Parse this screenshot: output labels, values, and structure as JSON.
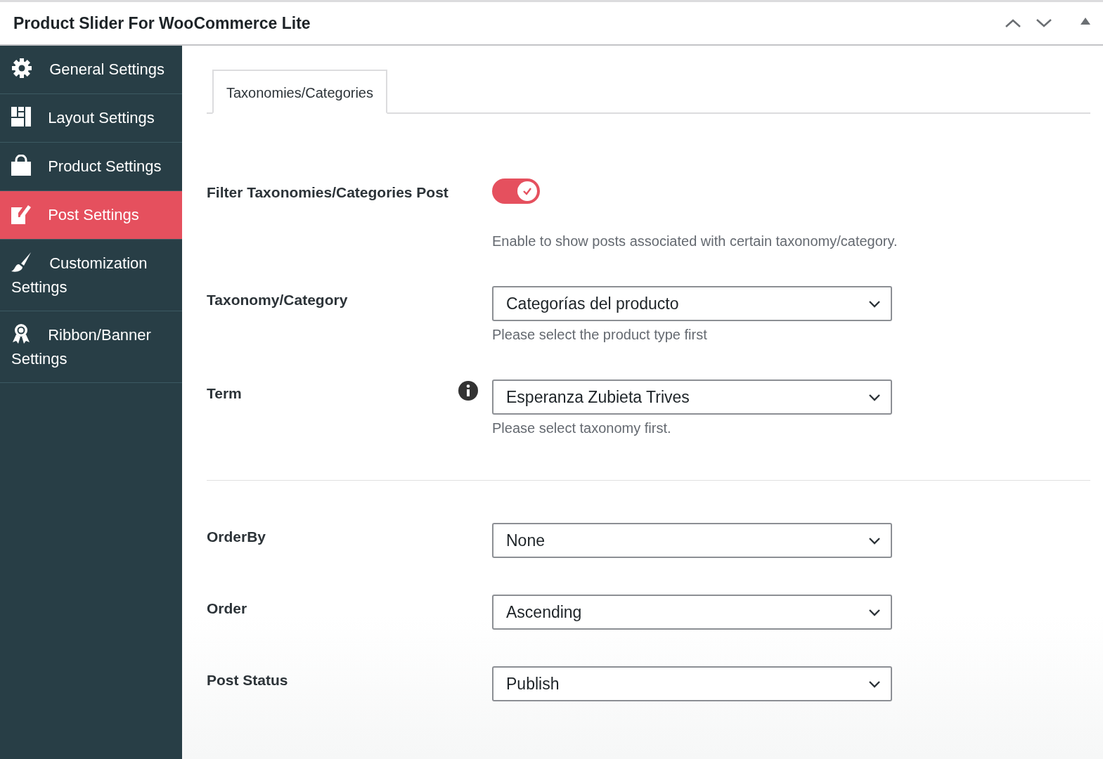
{
  "window": {
    "title": "Product Slider For WooCommerce Lite"
  },
  "header_controls": [
    {
      "kind": "up"
    },
    {
      "kind": "down"
    },
    {
      "kind": "collapse"
    }
  ],
  "sidebar": {
    "items": [
      {
        "label": "General Settings",
        "selected": false
      },
      {
        "label": "Layout Settings",
        "selected": false
      },
      {
        "label": "Product Settings",
        "selected": false
      },
      {
        "label": "Post Settings",
        "selected": true
      },
      {
        "label": "Customization Settings",
        "selected": false
      },
      {
        "label": "Ribbon/Banner Settings",
        "selected": false
      }
    ]
  },
  "tabs": [
    {
      "label": "Taxonomies/Categories",
      "selected": true
    }
  ],
  "sections": [
    {
      "fields": [
        {
          "kind": "toggle",
          "label": "Filter Taxonomies/Categories Post",
          "on": true,
          "help": "Enable to show posts associated with certain taxonomy/category."
        },
        {
          "kind": "select",
          "label": "Taxonomy/Category",
          "value": "Categorías del producto",
          "help": "Please select the product type first"
        },
        {
          "kind": "select",
          "label": "Term",
          "info": true,
          "value": "Esperanza Zubieta Trives",
          "help": "Please select taxonomy first."
        }
      ]
    },
    {
      "fields": [
        {
          "kind": "select",
          "label": "OrderBy",
          "value": "None"
        },
        {
          "kind": "select",
          "label": "Order",
          "value": "Ascending"
        },
        {
          "kind": "select",
          "label": "Post Status",
          "value": "Publish"
        }
      ]
    }
  ]
}
